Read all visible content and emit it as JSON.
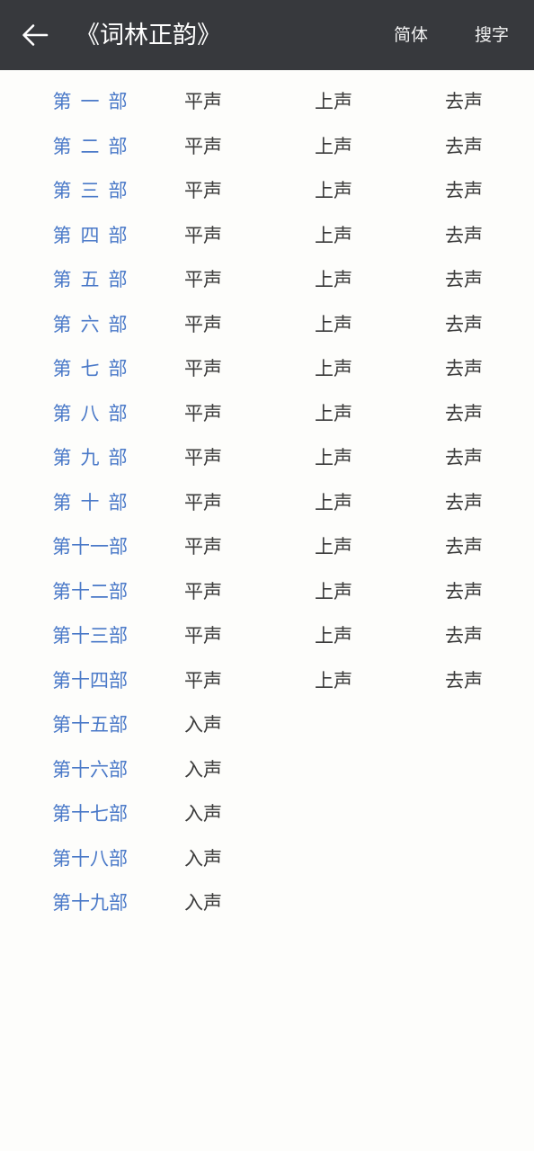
{
  "header": {
    "back_icon": "arrow-left-icon",
    "title": "《词林正韵》",
    "actions": [
      {
        "label": "简体",
        "name": "simplified"
      },
      {
        "label": "搜字",
        "name": "search-character"
      }
    ],
    "background_color": "#37393d",
    "title_color": "#ffffff"
  },
  "theme": {
    "page_background": "#fdfdfb",
    "link_color": "#4a79c8",
    "text_color": "#3a3a3a"
  },
  "list": {
    "rows": [
      {
        "part": "第一部",
        "spaced": true,
        "tones": [
          "平声",
          "上声",
          "去声"
        ]
      },
      {
        "part": "第二部",
        "spaced": true,
        "tones": [
          "平声",
          "上声",
          "去声"
        ]
      },
      {
        "part": "第三部",
        "spaced": true,
        "tones": [
          "平声",
          "上声",
          "去声"
        ]
      },
      {
        "part": "第四部",
        "spaced": true,
        "tones": [
          "平声",
          "上声",
          "去声"
        ]
      },
      {
        "part": "第五部",
        "spaced": true,
        "tones": [
          "平声",
          "上声",
          "去声"
        ]
      },
      {
        "part": "第六部",
        "spaced": true,
        "tones": [
          "平声",
          "上声",
          "去声"
        ]
      },
      {
        "part": "第七部",
        "spaced": true,
        "tones": [
          "平声",
          "上声",
          "去声"
        ]
      },
      {
        "part": "第八部",
        "spaced": true,
        "tones": [
          "平声",
          "上声",
          "去声"
        ]
      },
      {
        "part": "第九部",
        "spaced": true,
        "tones": [
          "平声",
          "上声",
          "去声"
        ]
      },
      {
        "part": "第十部",
        "spaced": true,
        "tones": [
          "平声",
          "上声",
          "去声"
        ]
      },
      {
        "part": "第十一部",
        "spaced": false,
        "tones": [
          "平声",
          "上声",
          "去声"
        ]
      },
      {
        "part": "第十二部",
        "spaced": false,
        "tones": [
          "平声",
          "上声",
          "去声"
        ]
      },
      {
        "part": "第十三部",
        "spaced": false,
        "tones": [
          "平声",
          "上声",
          "去声"
        ]
      },
      {
        "part": "第十四部",
        "spaced": false,
        "tones": [
          "平声",
          "上声",
          "去声"
        ]
      },
      {
        "part": "第十五部",
        "spaced": false,
        "tones": [
          "入声",
          "",
          ""
        ]
      },
      {
        "part": "第十六部",
        "spaced": false,
        "tones": [
          "入声",
          "",
          ""
        ]
      },
      {
        "part": "第十七部",
        "spaced": false,
        "tones": [
          "入声",
          "",
          ""
        ]
      },
      {
        "part": "第十八部",
        "spaced": false,
        "tones": [
          "入声",
          "",
          ""
        ]
      },
      {
        "part": "第十九部",
        "spaced": false,
        "tones": [
          "入声",
          "",
          ""
        ]
      }
    ]
  }
}
